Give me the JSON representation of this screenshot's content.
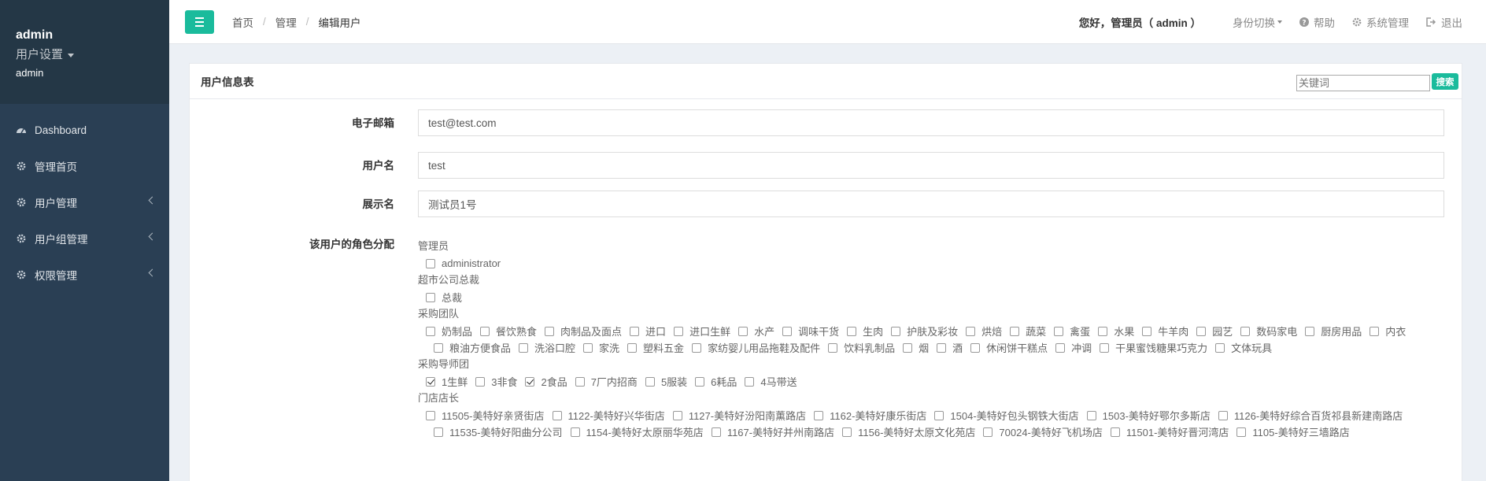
{
  "sidebar": {
    "user_name": "admin",
    "user_settings": "用户设置",
    "user_role": "admin",
    "items": [
      {
        "label": "Dashboard",
        "icon": "dashboard-icon"
      },
      {
        "label": "管理首页",
        "icon": "gear-icon"
      },
      {
        "label": "用户管理",
        "icon": "gear-icon"
      },
      {
        "label": "用户组管理",
        "icon": "gear-icon"
      },
      {
        "label": "权限管理",
        "icon": "gear-icon"
      }
    ]
  },
  "topbar": {
    "breadcrumb": [
      "首页",
      "管理",
      "编辑用户"
    ],
    "greeting": "您好，管理员（ admin ）",
    "switch_identity": "身份切换",
    "help": "帮助",
    "system_admin": "系统管理",
    "logout": "退出"
  },
  "panel": {
    "title": "用户信息表",
    "search_placeholder": "关键词",
    "search_button": "搜索"
  },
  "form": {
    "email_label": "电子邮箱",
    "email_value": "test@test.com",
    "username_label": "用户名",
    "username_value": "test",
    "display_label": "展示名",
    "display_value": "测试员1号",
    "roles_label": "该用户的角色分配"
  },
  "roles": {
    "admin_group": "管理员",
    "admin_items": [
      {
        "label": "administrator",
        "checked": false
      }
    ],
    "ceo_group": "超市公司总裁",
    "ceo_items": [
      {
        "label": "总裁",
        "checked": false
      }
    ],
    "purchase_group": "采购团队",
    "purchase_items_row1": [
      "奶制品",
      "餐饮熟食",
      "肉制品及面点",
      "进口",
      "进口生鲜",
      "水产",
      "调味干货",
      "生肉",
      "护肤及彩妆",
      "烘焙",
      "蔬菜",
      "禽蛋",
      "水果",
      "牛羊肉",
      "园艺",
      "数码家电",
      "厨房用品",
      "内衣"
    ],
    "purchase_items_row2": [
      "粮油方便食品",
      "洗浴口腔",
      "家洗",
      "塑料五金",
      "家纺婴儿用品拖鞋及配件",
      "饮料乳制品",
      "烟",
      "酒",
      "休闲饼干糕点",
      "冲调",
      "干果蜜饯糖果巧克力",
      "文体玩具"
    ],
    "mentor_group": "采购导师团",
    "mentor_items": [
      {
        "label": "1生鲜",
        "checked": true
      },
      {
        "label": "3非食",
        "checked": false
      },
      {
        "label": "2食品",
        "checked": true
      },
      {
        "label": "7厂内招商",
        "checked": false
      },
      {
        "label": "5服装",
        "checked": false
      },
      {
        "label": "6耗品",
        "checked": false
      },
      {
        "label": "4马带送",
        "checked": false
      }
    ],
    "store_group": "门店店长",
    "store_items_row1": [
      "11505-美特好亲贤街店",
      "1122-美特好兴华街店",
      "1127-美特好汾阳南薰路店",
      "1162-美特好康乐街店",
      "1504-美特好包头钢铁大街店",
      "1503-美特好鄂尔多斯店",
      "1126-美特好综合百货祁县新建南路店"
    ],
    "store_items_row2": [
      "11535-美特好阳曲分公司",
      "1154-美特好太原丽华苑店",
      "1167-美特好并州南路店",
      "1156-美特好太原文化苑店",
      "70024-美特好飞机场店",
      "11501-美特好晋河湾店",
      "1105-美特好三墙路店"
    ]
  },
  "colors": {
    "sidebar_bg": "#2a3f54",
    "accent": "#1abb9c"
  }
}
